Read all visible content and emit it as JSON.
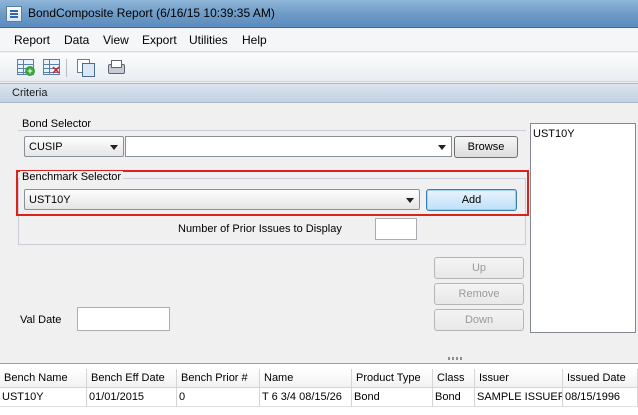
{
  "window": {
    "title": "BondComposite Report (6/16/15 10:39:35 AM)"
  },
  "menu": {
    "items": [
      "Report",
      "Data",
      "View",
      "Export",
      "Utilities",
      "Help"
    ]
  },
  "toolbar": {
    "icons": [
      "add-grid-icon",
      "delete-grid-icon",
      "copy-icon",
      "print-icon"
    ]
  },
  "criteria": {
    "header": "Criteria",
    "bond_selector": {
      "label": "Bond Selector",
      "type_value": "CUSIP",
      "search_value": "",
      "browse_label": "Browse"
    },
    "benchmark_selector": {
      "label": "Benchmark Selector",
      "value": "UST10Y",
      "add_label": "Add"
    },
    "prior_issues": {
      "label": "Number of Prior Issues to Display",
      "value": ""
    },
    "val_date": {
      "label": "Val Date",
      "value": ""
    },
    "buttons": {
      "up": "Up",
      "remove": "Remove",
      "down": "Down"
    },
    "benchmark_list": [
      "UST10Y"
    ]
  },
  "grid": {
    "columns": [
      "Bench Name",
      "Bench Eff Date",
      "Bench Prior #",
      "Name",
      "Product Type",
      "Class",
      "Issuer",
      "Issued Date"
    ],
    "rows": [
      [
        "UST10Y",
        "01/01/2015",
        "0",
        "T 6 3/4 08/15/26",
        "Bond",
        "Bond",
        "SAMPLE ISSUER",
        "08/15/1996"
      ]
    ]
  },
  "colors": {
    "highlight": "#d9231c",
    "focus_button": "#bfe0f8"
  }
}
